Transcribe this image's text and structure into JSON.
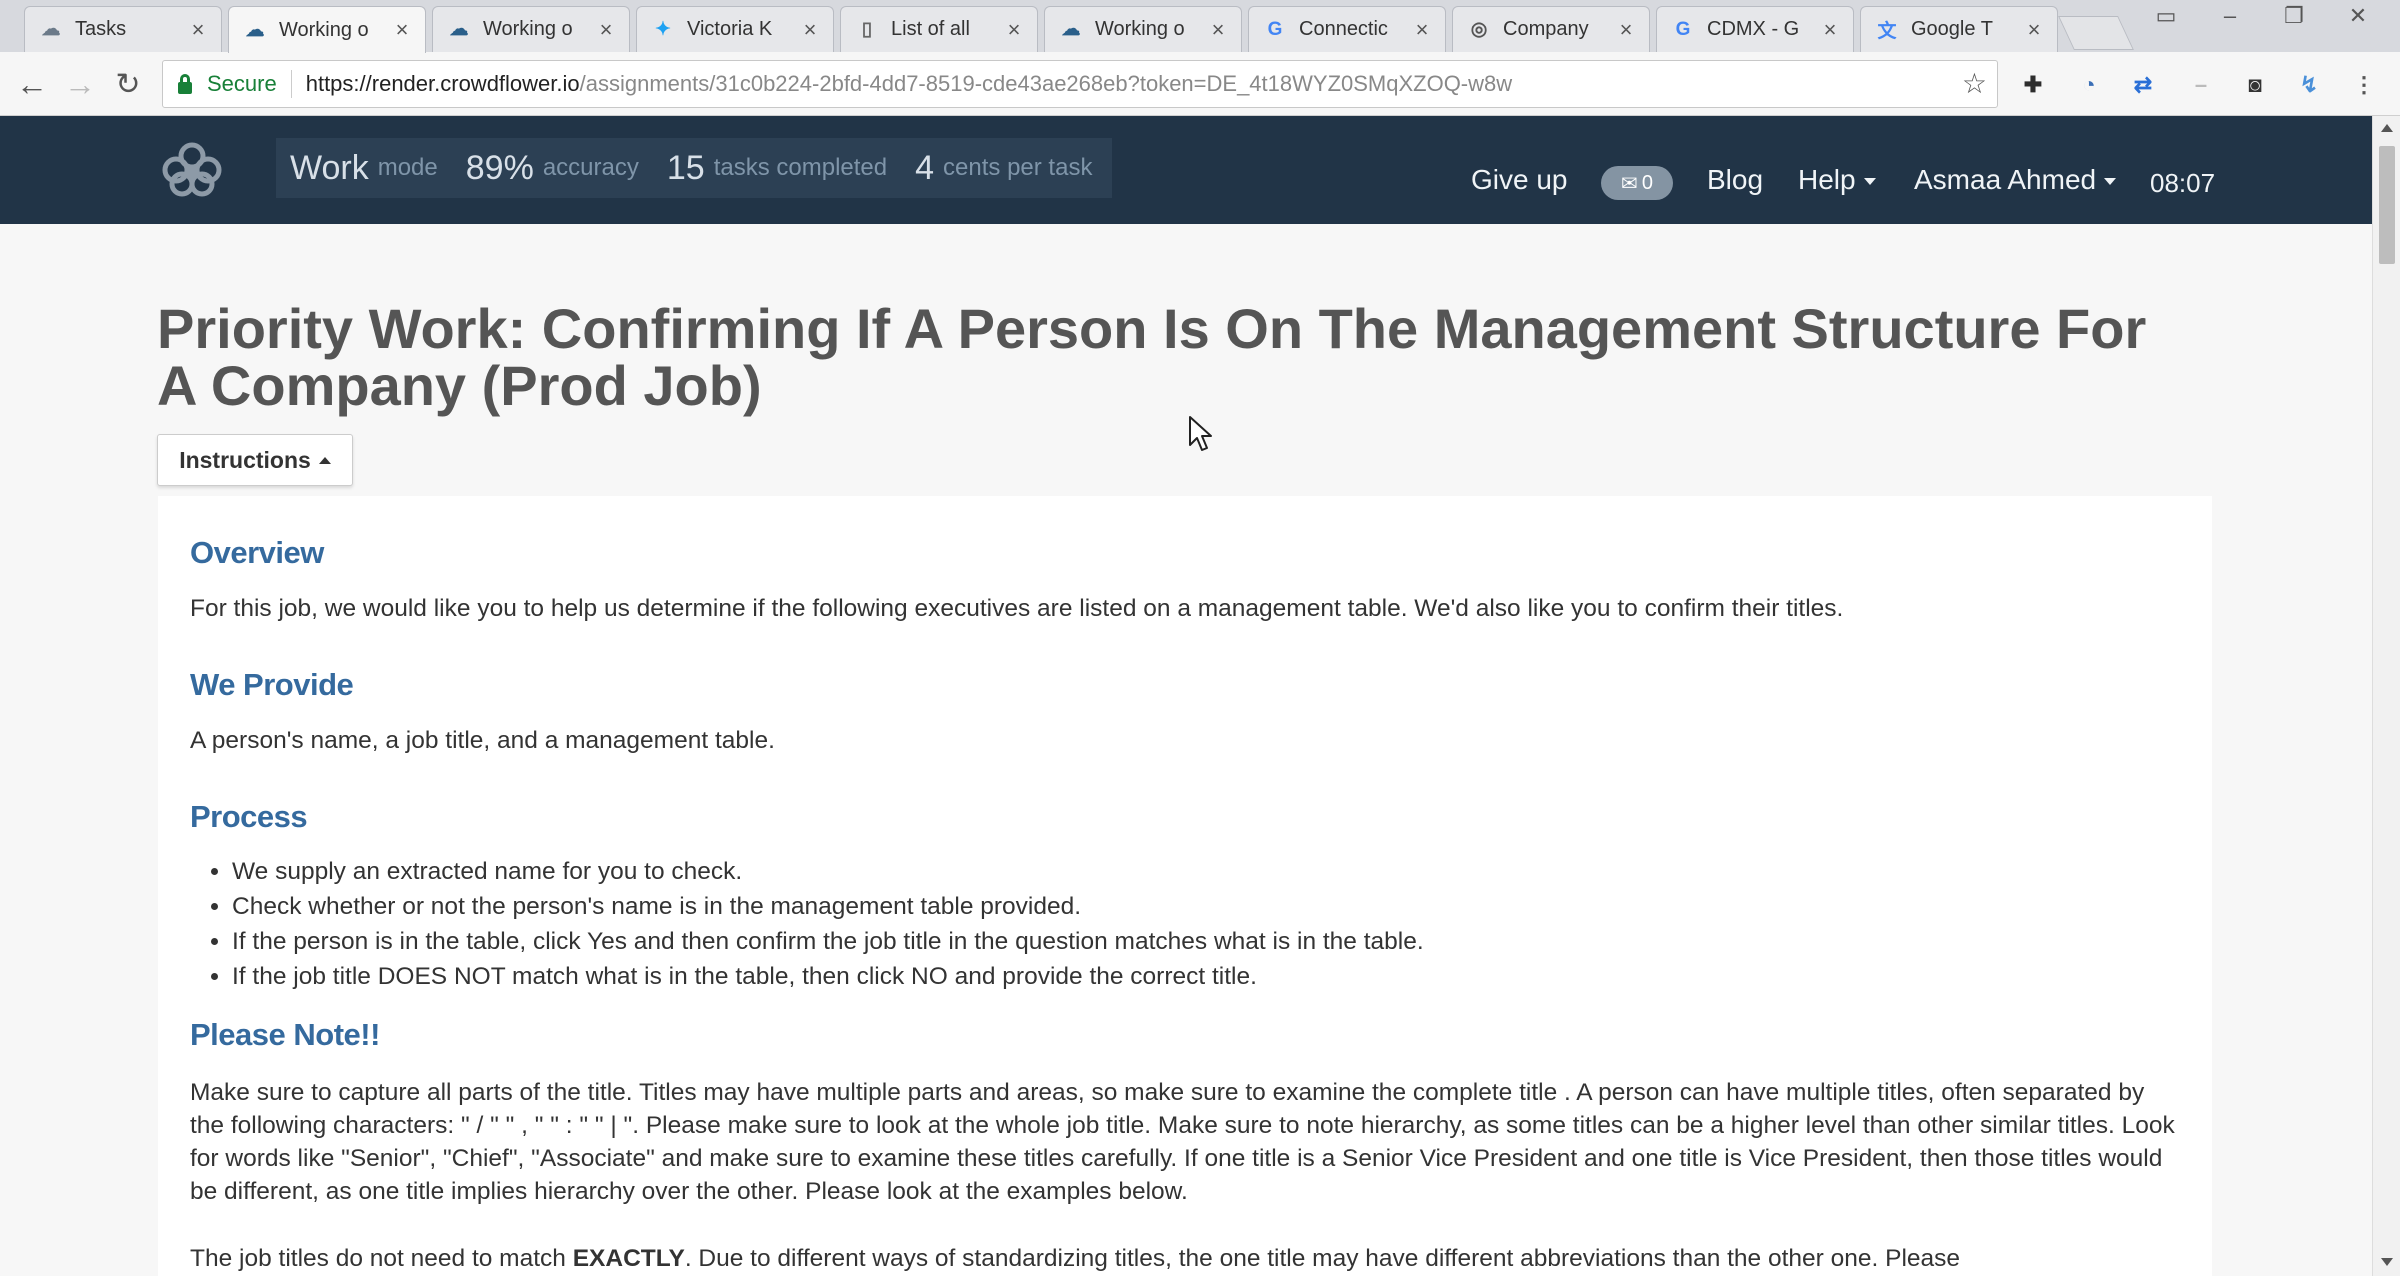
{
  "browser": {
    "tabs": [
      {
        "title": "Tasks",
        "icon": "crowdflower-favicon",
        "active": false
      },
      {
        "title": "Working o",
        "icon": "crowdflower-favicon",
        "active": true
      },
      {
        "title": "Working o",
        "icon": "crowdflower-favicon",
        "active": false
      },
      {
        "title": "Victoria K",
        "icon": "twitter-favicon",
        "active": false
      },
      {
        "title": "List of all",
        "icon": "page-favicon",
        "active": false
      },
      {
        "title": "Working o",
        "icon": "crowdflower-favicon",
        "active": false
      },
      {
        "title": "Connectic",
        "icon": "google-favicon",
        "active": false
      },
      {
        "title": "Company",
        "icon": "globe-favicon",
        "active": false
      },
      {
        "title": "CDMX - G",
        "icon": "google-favicon",
        "active": false
      },
      {
        "title": "Google T",
        "icon": "google-translate-favicon",
        "active": false
      }
    ],
    "secure_label": "Secure",
    "url_host": "https://render.crowdflower.io",
    "url_path": "/assignments/31c0b224-2bfd-4dd7-8519-cde43ae268eb?token=DE_4t18WYZ0SMqXZOQ-w8w"
  },
  "header": {
    "mode_value": "Work",
    "mode_label": "mode",
    "accuracy_value": "89%",
    "accuracy_label": "accuracy",
    "tasks_value": "15",
    "tasks_label": "tasks completed",
    "cents_value": "4",
    "cents_label": "cents per task",
    "give_up": "Give up",
    "mail_count": "0",
    "blog": "Blog",
    "help": "Help",
    "user": "Asmaa Ahmed",
    "timer": "08:07"
  },
  "job": {
    "title": "Priority Work: Confirming If A Person Is On The Management Structure For A Company (Prod Job)",
    "instructions_button": "Instructions"
  },
  "instructions": {
    "overview_heading": "Overview",
    "overview_text": "For this job, we would like you to help us determine if  the following executives are listed on a management table. We'd also like you to confirm their titles.",
    "provide_heading": "We Provide",
    "provide_text": "A person's name, a job title, and a management table.",
    "process_heading": "Process",
    "process_items": [
      "We supply an extracted name for you to check.",
      "Check whether or not the person's name is in the management table provided.",
      "If the person is in the table, click Yes and then confirm the job title in the question matches what is in the table.",
      "If the job title DOES NOT match what is in the table, then click NO and provide the correct title."
    ],
    "note_heading": "Please Note!!",
    "note_text": "Make sure to capture all parts of the title. Titles may have multiple parts and areas, so make sure to examine the complete title . A person can have multiple titles, often separated by the following characters:  \" / \" \" , \" \" : \" \" | \". Please make sure to look at the whole job title. Make sure to note hierarchy, as some titles can be a higher level than  other similar titles. Look for words like \"Senior\", \"Chief\", \"Associate\" and make sure to examine these titles carefully.  If one title is a Senior Vice President and one title is  Vice President, then those titles would be different, as one title implies hierarchy over the other. Please look at the examples below.",
    "match_text_prefix": "The job titles do not need to match ",
    "match_text_bold": "EXACTLY",
    "match_text_suffix": ". Due to different ways of standardizing titles, the one title may have different abbreviations than the other one. Please"
  }
}
